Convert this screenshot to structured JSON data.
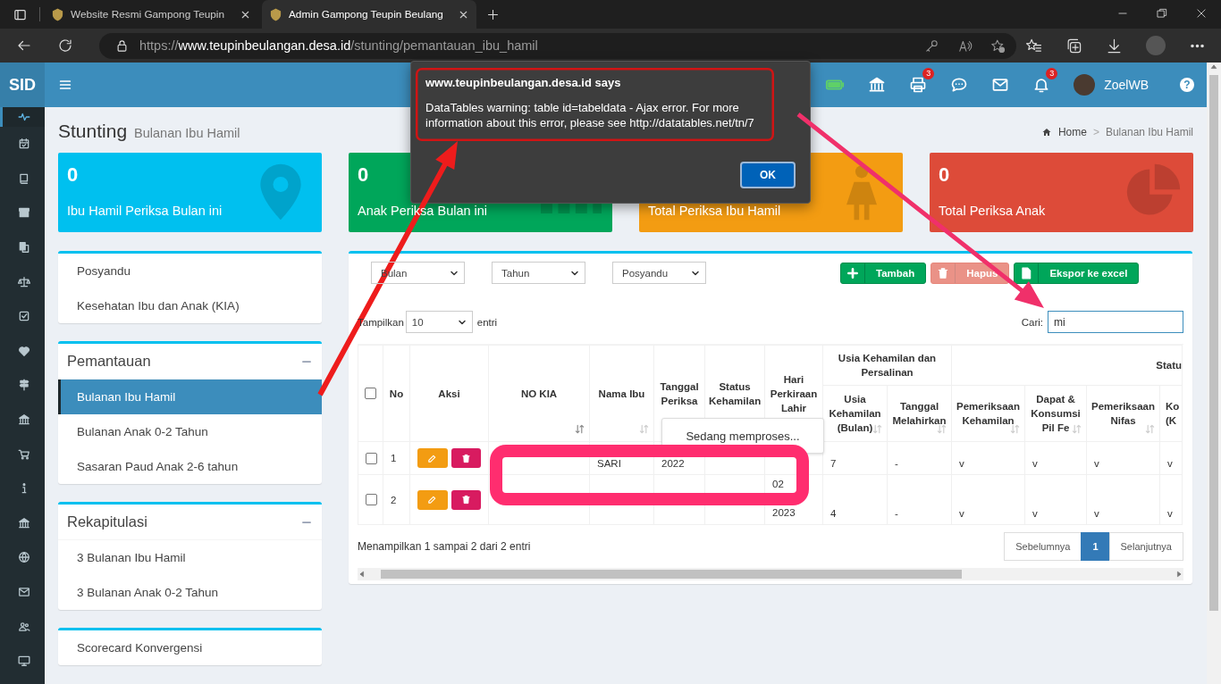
{
  "browser": {
    "tabs": [
      {
        "title": "Website Resmi Gampong Teupin",
        "selected": false
      },
      {
        "title": "Admin Gampong Teupin Beulang",
        "selected": true
      }
    ],
    "url": {
      "scheme": "https://",
      "host": "www.teupinbeulangan.desa.id",
      "path": "/stunting/pemantauan_ibu_hamil"
    }
  },
  "app": {
    "logo": "SID",
    "side_nav": [
      {
        "kind": "heartbeat",
        "selected": true
      },
      {
        "kind": "calendar",
        "selected": false
      },
      {
        "kind": "book",
        "selected": false
      },
      {
        "kind": "archive",
        "selected": false
      },
      {
        "kind": "copy",
        "selected": false
      },
      {
        "kind": "scale",
        "selected": false
      },
      {
        "kind": "checkbox",
        "selected": false
      },
      {
        "kind": "heart",
        "selected": false
      },
      {
        "kind": "signpost",
        "selected": false
      },
      {
        "kind": "bank",
        "selected": false
      },
      {
        "kind": "cart",
        "selected": false
      },
      {
        "kind": "info",
        "selected": false
      },
      {
        "kind": "bank",
        "selected": false
      },
      {
        "kind": "globe",
        "selected": false
      },
      {
        "kind": "mail",
        "selected": false
      },
      {
        "kind": "users",
        "selected": false
      },
      {
        "kind": "monitor",
        "selected": false
      }
    ],
    "header": [
      {
        "kind": "battery"
      },
      {
        "kind": "bank"
      },
      {
        "kind": "printer",
        "badge": "3"
      },
      {
        "kind": "chat"
      },
      {
        "kind": "mail"
      },
      {
        "kind": "bell",
        "badge": "3"
      },
      {
        "kind": "user",
        "name": "ZoelWB"
      },
      {
        "kind": "help",
        "label": "?"
      }
    ]
  },
  "page": {
    "title": "Stunting",
    "subtitle": "Bulanan Ibu Hamil",
    "breadcrumb": [
      {
        "label": "Home"
      },
      {
        "label": "Bulanan Ibu Hamil"
      }
    ],
    "breadcrumb_separator": ">"
  },
  "info_boxes": [
    {
      "kind": "pin",
      "value": "0",
      "label": "Ibu Hamil Periksa Bulan ini",
      "color": "#00c0ef"
    },
    {
      "kind": "bars",
      "value": "0",
      "label": "Anak Periksa Bulan ini",
      "color": "#00a65a"
    },
    {
      "kind": "person",
      "label": "Total Periksa Ibu Hamil",
      "color": "#f39c12"
    },
    {
      "kind": "pie",
      "value": "0",
      "label": "Total Periksa Anak",
      "color": "#dd4b39"
    }
  ],
  "menus": [
    {
      "items": [
        {
          "label": "Posyandu",
          "selected": false
        },
        {
          "label": "Kesehatan Ibu dan Anak (KIA)",
          "selected": false
        }
      ]
    },
    {
      "title": "Pemantauan",
      "items": [
        {
          "label": "Bulanan Ibu Hamil",
          "selected": true
        },
        {
          "label": "Bulanan Anak 0-2 Tahun",
          "selected": false
        },
        {
          "label": "Sasaran Paud Anak 2-6 tahun",
          "selected": false
        }
      ]
    },
    {
      "title": "Rekapitulasi",
      "items": [
        {
          "label": "3 Bulanan Ibu Hamil",
          "selected": false
        },
        {
          "label": "3 Bulanan Anak 0-2 Tahun",
          "selected": false
        }
      ]
    },
    {
      "items": [
        {
          "label": "Scorecard Konvergensi",
          "selected": false
        }
      ]
    }
  ],
  "filters": [
    {
      "value": "Bulan"
    },
    {
      "value": "Tahun"
    },
    {
      "value": "Posyandu"
    }
  ],
  "buttons": [
    {
      "kind": "add",
      "label": "Tambah",
      "disabled": false
    },
    {
      "kind": "delete",
      "label": "Hapus",
      "disabled": true
    },
    {
      "kind": "export",
      "label": "Ekspor ke excel",
      "disabled": false
    }
  ],
  "length": {
    "before": "Tampilkan",
    "value": "10",
    "after": "entri"
  },
  "search": {
    "label": "Cari:",
    "value": "mi"
  },
  "table": {
    "columns": [
      {
        "kind": "check",
        "checked": false
      },
      {
        "label": "No"
      },
      {
        "label": "Aksi"
      },
      {
        "label": "NO KIA",
        "sortable": true,
        "sorted": true
      },
      {
        "label": "Nama Ibu",
        "sortable": true,
        "sorted": false
      },
      {
        "label": "Tanggal Periksa"
      },
      {
        "label": "Status Kehamilan"
      },
      {
        "label": "Hari Perkiraan Lahir"
      },
      {
        "label": "Usia Kehamilan dan Persalinan",
        "colspan": 2,
        "children": [
          {
            "label": "Usia Kehamilan (Bulan)",
            "sortable": true,
            "sorted": false
          },
          {
            "label": "Tanggal Melahirkan",
            "sortable": true,
            "sorted": false
          }
        ]
      },
      {
        "label": "Statu",
        "colspan": 4,
        "children": [
          {
            "label": "Pemeriksaan Kehamilan",
            "sortable": true,
            "sorted": false
          },
          {
            "label": "Dapat & Konsumsi Pil Fe",
            "sortable": true,
            "sorted": false
          },
          {
            "label": "Pemeriksaan Nifas",
            "sortable": true,
            "sorted": false
          },
          {
            "label": "Ko (K"
          }
        ]
      }
    ],
    "rows": [
      {
        "cells": [
          {
            "kind": "check",
            "checked": false
          },
          "1",
          {
            "kind": "actions"
          },
          "",
          "SARI",
          "2022",
          "",
          "",
          "7",
          "-",
          "v",
          "v",
          "v",
          "v"
        ]
      },
      {
        "cells": [
          {
            "kind": "check",
            "checked": false
          },
          "2",
          {
            "kind": "actions"
          },
          "",
          "",
          "",
          "",
          [
            "02",
            "2023"
          ],
          "4",
          "-",
          "v",
          "v",
          "v",
          "v"
        ]
      }
    ]
  },
  "processing": "Sedang memproses...",
  "footer": {
    "info": "Menampilkan 1 sampai 2 dari 2 entri",
    "pages": [
      {
        "label": "Sebelumnya",
        "selected": false
      },
      {
        "label": "1",
        "selected": true
      },
      {
        "label": "Selanjutnya",
        "selected": false
      }
    ]
  },
  "dialog": {
    "title": "www.teupinbeulangan.desa.id says",
    "message": "DataTables warning: table id=tabeldata - Ajax error. For more information about this error, please see http://datatables.net/tn/7",
    "button": "OK"
  }
}
